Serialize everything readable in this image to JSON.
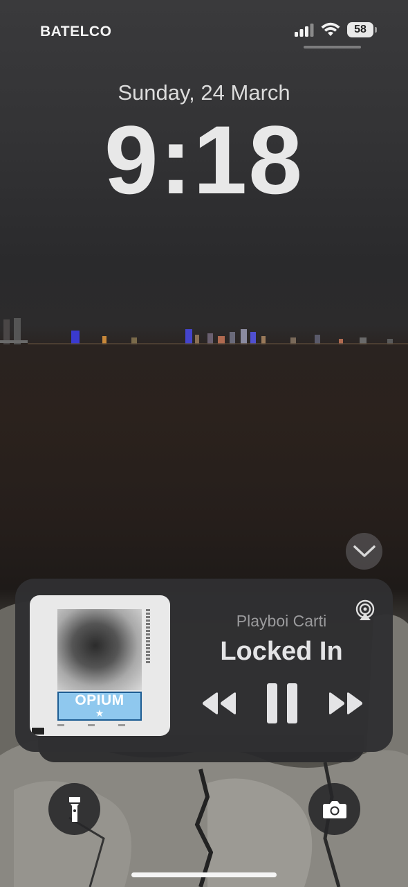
{
  "status_bar": {
    "carrier": "BATELCO",
    "signal_bars": 3,
    "wifi_icon": "wifi-icon",
    "battery_level": "58"
  },
  "lock_screen": {
    "date": "Sunday, 24 March",
    "time": "9:18"
  },
  "now_playing": {
    "artist": "Playboi Carti",
    "track": "Locked In",
    "album_art_title": "OPIUM",
    "album_art_star": "★",
    "controls": {
      "previous_icon": "rewind-icon",
      "pause_icon": "pause-icon",
      "next_icon": "fast-forward-icon",
      "airplay_icon": "airplay-icon"
    }
  },
  "shortcuts": {
    "left": "flashlight-icon",
    "right": "camera-icon"
  },
  "colors": {
    "widget_bg": "#303032",
    "text_primary": "#e4e4e6",
    "text_secondary": "#9a9a9c",
    "album_banner": "#8fc8ee"
  }
}
